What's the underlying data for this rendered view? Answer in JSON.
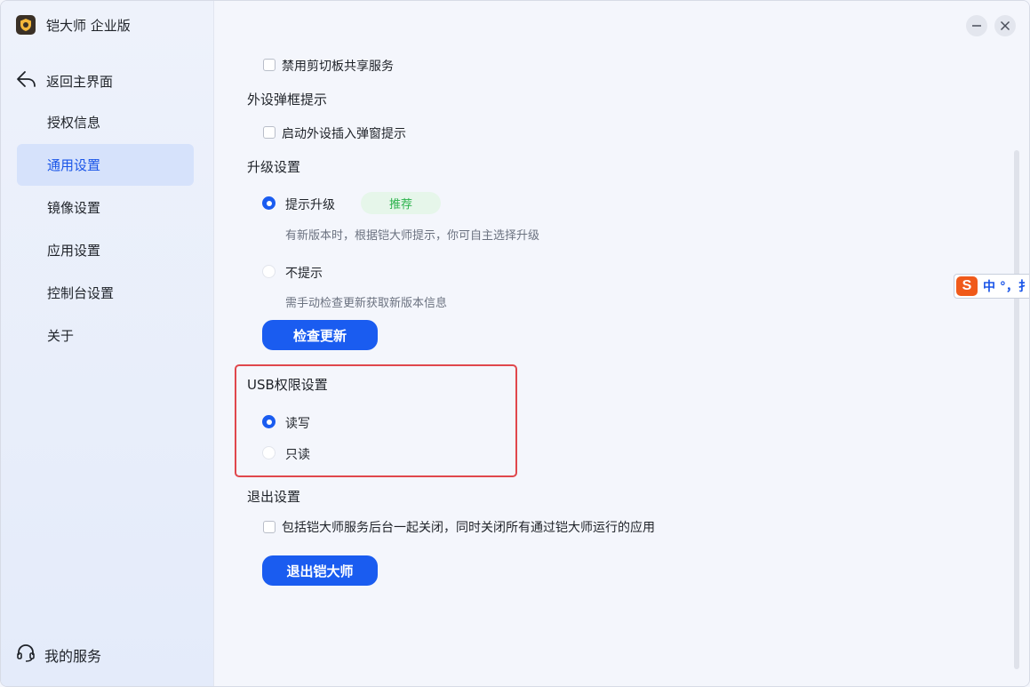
{
  "app": {
    "title": "铠大师 企业版"
  },
  "sidebar": {
    "back_label": "返回主界面",
    "items": [
      {
        "label": "授权信息",
        "active": false
      },
      {
        "label": "通用设置",
        "active": true
      },
      {
        "label": "镜像设置",
        "active": false
      },
      {
        "label": "应用设置",
        "active": false
      },
      {
        "label": "控制台设置",
        "active": false
      },
      {
        "label": "关于",
        "active": false
      }
    ],
    "service_label": "我的服务"
  },
  "settings": {
    "clipboard": {
      "checkbox_label": "禁用剪切板共享服务",
      "checked": false
    },
    "peripheral": {
      "heading": "外设弹框提示",
      "checkbox_label": "启动外设插入弹窗提示",
      "checked": false
    },
    "upgrade": {
      "heading": "升级设置",
      "options": [
        {
          "label": "提示升级",
          "selected": true,
          "tag": "推荐",
          "hint": "有新版本时，根据铠大师提示，你可自主选择升级"
        },
        {
          "label": "不提示",
          "selected": false,
          "hint": "需手动检查更新获取新版本信息"
        }
      ],
      "check_button": "检查更新"
    },
    "usb": {
      "heading": "USB权限设置",
      "options": [
        {
          "label": "读写",
          "selected": true
        },
        {
          "label": "只读",
          "selected": false
        }
      ]
    },
    "exit": {
      "heading": "退出设置",
      "checkbox_label": "包括铠大师服务后台一起关闭，同时关闭所有通过铠大师运行的应用",
      "checked": false,
      "exit_button": "退出铠大师"
    }
  },
  "ime": {
    "text": "中 °，扌"
  },
  "colors": {
    "accent": "#1a5cf0",
    "active_nav_bg": "#d6e2fb",
    "highlight_border": "#e0474c",
    "recommend_tag_bg": "#e6f6ea",
    "recommend_tag_text": "#2bb24c"
  }
}
